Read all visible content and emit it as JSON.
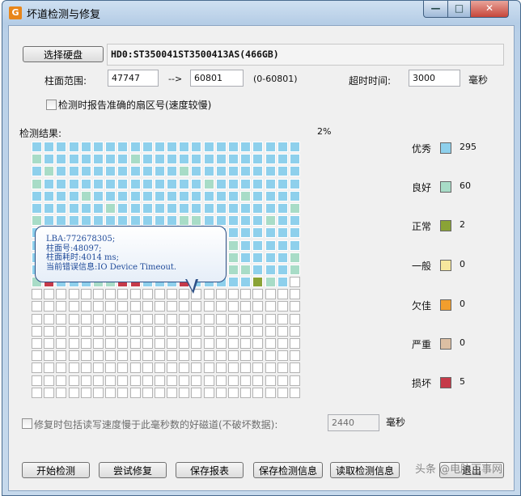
{
  "window": {
    "title": "坏道检测与修复",
    "app_icon": "G",
    "min_symbol": "—",
    "max_symbol": "□",
    "close_symbol": "✕"
  },
  "disk": {
    "select_label": "选择硬盘",
    "name": "HD0:ST350041ST3500413AS(466GB)"
  },
  "range": {
    "label": "柱面范围:",
    "from": "47747",
    "arrow": "-->",
    "to": "60801",
    "total": "(0-60801)"
  },
  "timeout": {
    "label": "超时时间:",
    "value": "3000",
    "unit": "毫秒"
  },
  "accurate_check": {
    "label": "检测时报告准确的扇区号(速度较慢)",
    "checked": false
  },
  "results": {
    "label": "检测结果:",
    "percent": "2%"
  },
  "legend": [
    {
      "name": "优秀",
      "color": "#8ed0ec",
      "count": "295"
    },
    {
      "name": "良好",
      "color": "#a8dcc7",
      "count": "60"
    },
    {
      "name": "正常",
      "color": "#8aa336",
      "count": "2"
    },
    {
      "name": "一般",
      "color": "#f7e79d",
      "count": "0"
    },
    {
      "name": "欠佳",
      "color": "#f29e2d",
      "count": "0"
    },
    {
      "name": "严重",
      "color": "#dcbfa3",
      "count": "0"
    },
    {
      "name": "损坏",
      "color": "#c53a49",
      "count": "5"
    }
  ],
  "tooltip": {
    "lines": [
      "LBA:772678305;",
      "柱面号:48097;",
      "柱面耗时:4014 ms;",
      "当前错误信息:IO Device Timeout."
    ]
  },
  "repair_option": {
    "label": "修复时包括读写速度慢于此毫秒数的好磁道(不破坏数据):",
    "value": "2440",
    "unit": "毫秒",
    "checked": false
  },
  "buttons": {
    "start": "开始检测",
    "try_repair": "尝试修复",
    "save_report": "保存报表",
    "save_info": "保存检测信息",
    "read_info": "读取检测信息",
    "exit": "退出"
  },
  "watermark": "头条 @电脑百事网",
  "grid": {
    "columns": 22,
    "rows": 21,
    "rows_data": [
      "EEEEEEEEEEEEEEEEEEEEEE",
      "GEEEEEEEGEEEEEEEEEEEEE",
      "EGEEEEEEEEEEGEEEEEEEEE",
      "GEEEEEEEEEEEEEGEEEEEEE",
      "EEEEGEEEEEEEEEEEEGEEEE",
      "EEEEEEGEEEEEEEEEEEEEEG",
      "GEEEEEEEEEEEGGEEEEEGEE",
      "EEEEEEEEEEEEEEEEEEEEEE",
      "EEEEEEEEEEEEEEEEGEEEEE",
      "EEGEEEGEEGEEEEEEGEEEEG",
      "EBNEEEEEEEEEGEEGGGEEEG",
      "GBEEEGGBBEEEBEEEEENGEW",
      "WWWWWWWWWWWWWWWWWWWWWW",
      "WWWWWWWWWWWWWWWWWWWWWW",
      "WWWWWWWWWWWWWWWWWWWWWW",
      "WWWWWWWWWWWWWWWWWWWWWW",
      "WWWWWWWWWWWWWWWWWWWWWW",
      "WWWWWWWWWWWWWWWWWWWWWW",
      "WWWWWWWWWWWWWWWWWWWWWW",
      "WWWWWWWWWWWWWWWWWWWWWW",
      "WWWWWWWWWWWWWWWWWWWWWW"
    ],
    "colors": {
      "E": "#8ed0ec",
      "G": "#a8dcc7",
      "N": "#8aa336",
      "B": "#c53a49",
      "W": "#ffffff"
    }
  }
}
